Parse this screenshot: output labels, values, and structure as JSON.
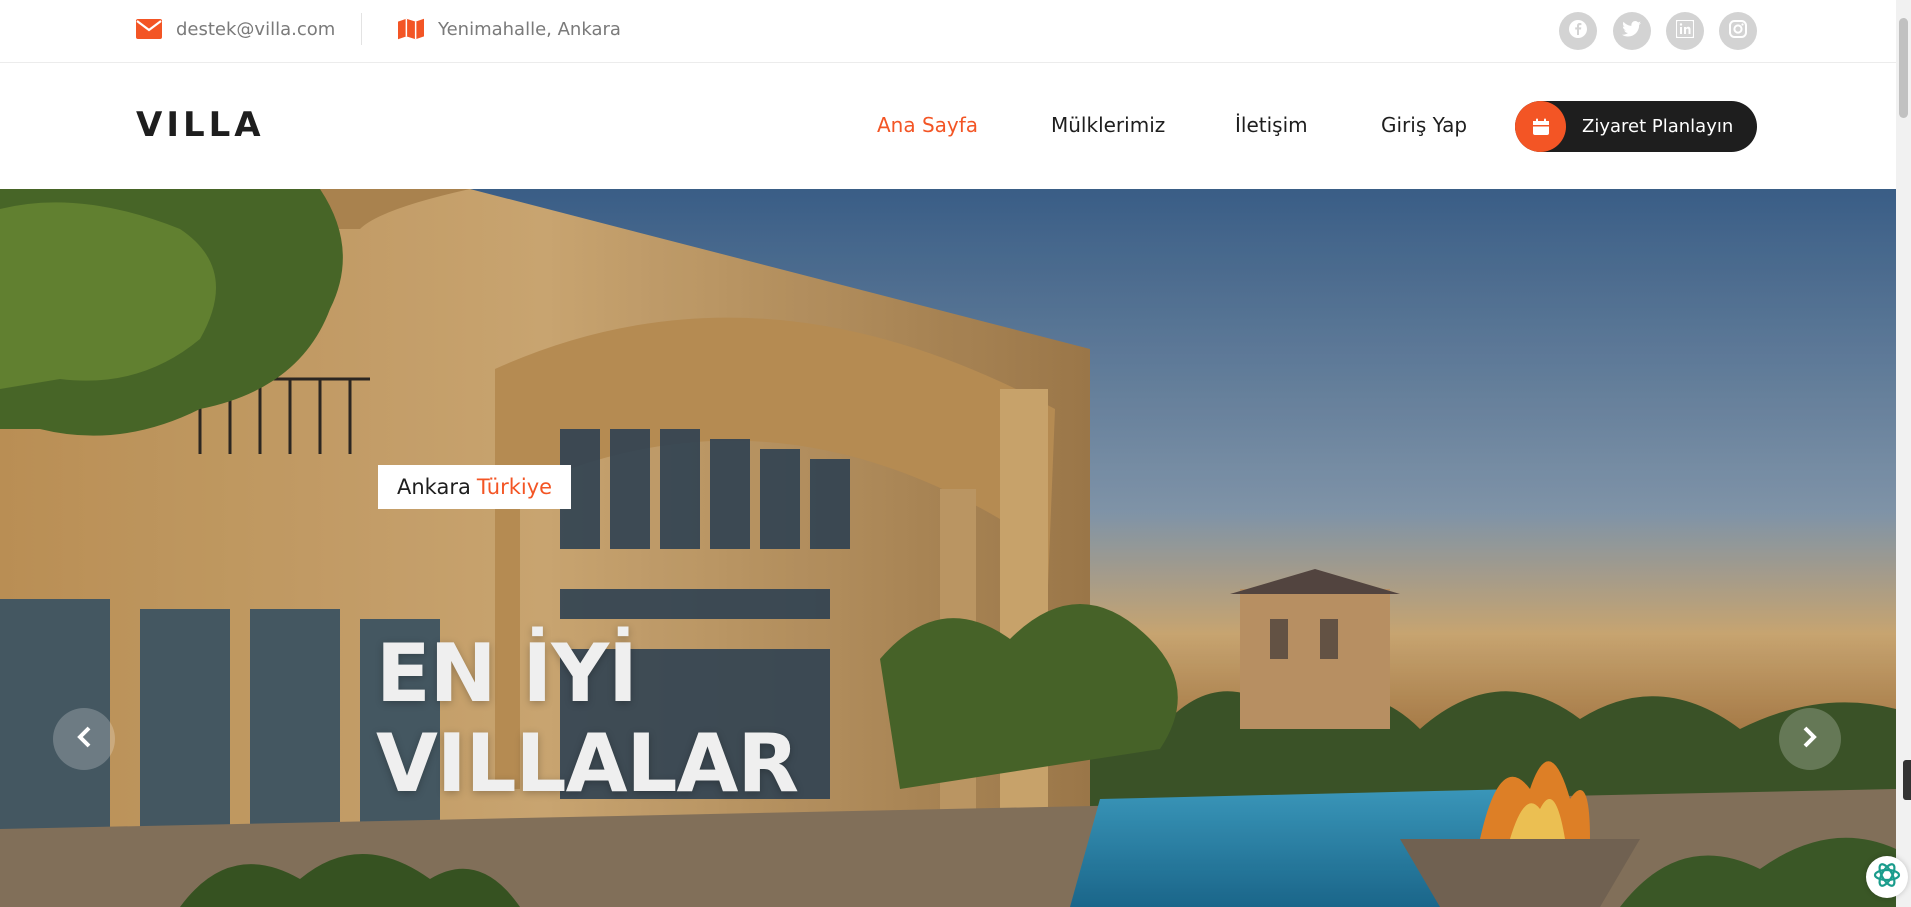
{
  "topbar": {
    "email": "destek@villa.com",
    "email_icon": "envelope-icon",
    "address": "Yenimahalle, Ankara",
    "address_icon": "map-icon",
    "social": [
      "facebook-icon",
      "twitter-icon",
      "linkedin-icon",
      "instagram-icon"
    ]
  },
  "nav": {
    "logo": "VILLA",
    "menu": [
      {
        "label": "Ana Sayfa",
        "active": true
      },
      {
        "label": "Mülklerimiz",
        "active": false
      },
      {
        "label": "İletişim",
        "active": false
      },
      {
        "label": "Giriş Yap",
        "active": false
      }
    ],
    "cta_label": "Ziyaret Planlayın",
    "cta_icon": "calendar-icon"
  },
  "hero": {
    "tag_city": "Ankara",
    "tag_country": "Türkiye",
    "headline_line1": "EN İYİ",
    "headline_line2": "VILLALAR",
    "prev_icon": "chevron-left-icon",
    "next_icon": "chevron-right-icon"
  },
  "colors": {
    "accent": "#f35525",
    "dark": "#1e1e1e",
    "muted_text": "#7a7a7a"
  }
}
